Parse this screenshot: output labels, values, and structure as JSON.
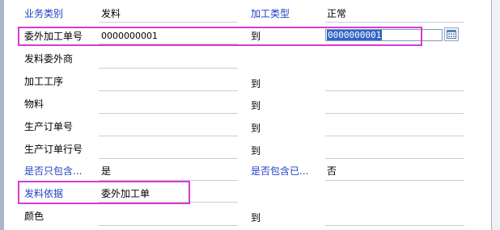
{
  "form": {
    "business_type": {
      "label": "业务类别",
      "value": "发料"
    },
    "process_type": {
      "label": "加工类型",
      "value": "正常"
    },
    "outsourcing_order_no": {
      "label": "委外加工单号",
      "from": "0000000001",
      "to_label": "到",
      "to": "0000000001"
    },
    "supplier": {
      "label": "发料委外商"
    },
    "process": {
      "label": "加工工序",
      "to_label": "到"
    },
    "material": {
      "label": "物料",
      "to_label": "到"
    },
    "production_order_no": {
      "label": "生产订单号",
      "to_label": "到"
    },
    "production_order_line": {
      "label": "生产订单行号",
      "to_label": "到"
    },
    "only_include": {
      "label": "是否只包含...",
      "value": "是"
    },
    "include_already": {
      "label": "是否包含已...",
      "value": "否"
    },
    "issue_basis": {
      "label": "发料依据",
      "value": "委外加工单"
    },
    "color": {
      "label": "颜色",
      "to_label": "到"
    }
  },
  "icons": {
    "picker": "calendar-grid-icon"
  },
  "colors": {
    "label_blue": "#1f3fc0",
    "highlight": "#d63bd6",
    "selection": "#3165c8"
  }
}
